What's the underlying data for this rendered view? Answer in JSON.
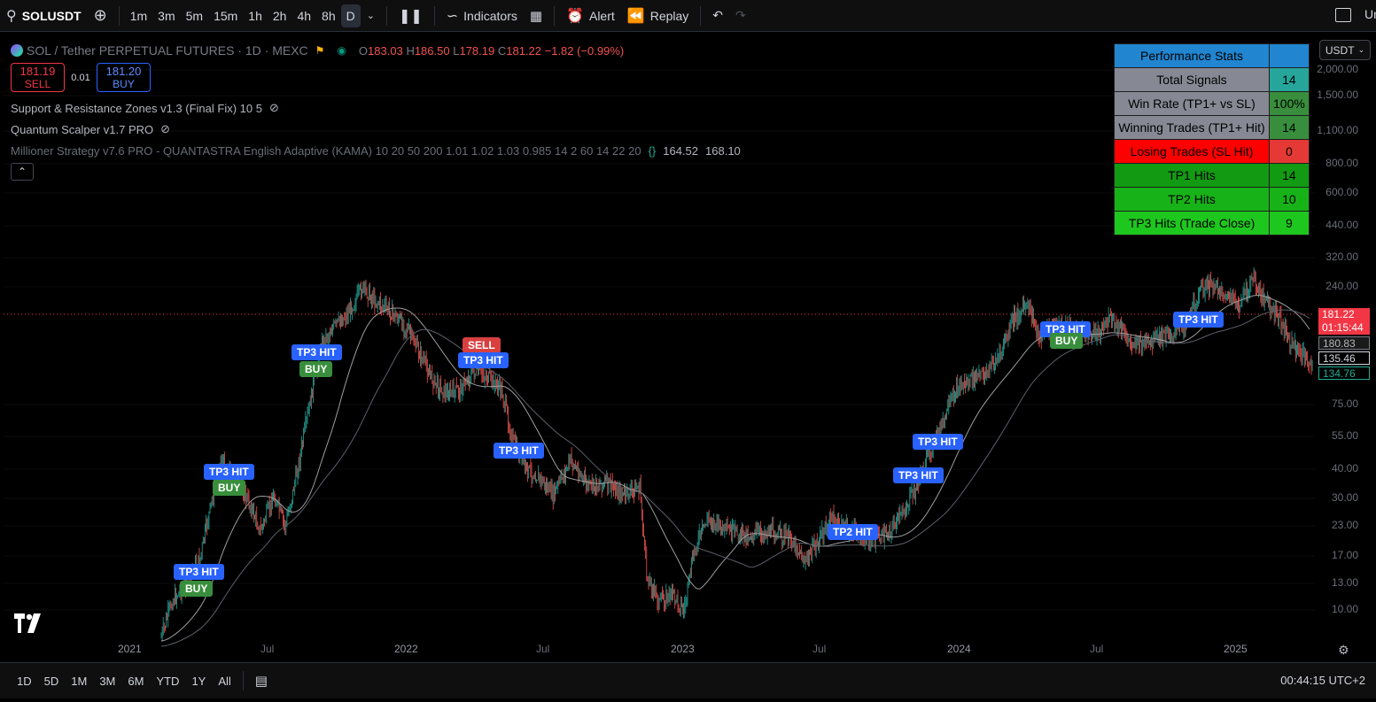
{
  "toolbar": {
    "symbol": "SOLUSDT",
    "timeframes": [
      "1m",
      "3m",
      "5m",
      "15m",
      "1h",
      "2h",
      "4h",
      "8h",
      "D"
    ],
    "active_timeframe": "D",
    "indicators_label": "Indicators",
    "alert_label": "Alert",
    "replay_label": "Replay",
    "right_cut_text": "Un"
  },
  "legend": {
    "title": "SOL / Tether PERPETUAL FUTURES · 1D · MEXC",
    "o_key": "O",
    "o_val": "183.03",
    "h_key": "H",
    "h_val": "186.50",
    "l_key": "L",
    "l_val": "178.19",
    "c_key": "C",
    "c_val": "181.22",
    "change": "−1.82 (−0.99%)",
    "sell_price": "181.19",
    "sell_label": "SELL",
    "spread": "0.01",
    "buy_price": "181.20",
    "buy_label": "BUY",
    "indicator1": "Support & Resistance Zones v1.3 (Final Fix) 10 5",
    "indicator2": "Quantum Scalper v1.7 PRO",
    "indicator3": "Millioner Strategy v7.6 PRO - QUANTASTRA English Adaptive (KAMA) 10 20 50 200 1.01 1.02 1.03 0.985 14 2 60 14 22 20",
    "indicator3_v1": "164.52",
    "indicator3_v2": "168.10"
  },
  "stats": {
    "header": "Performance Stats",
    "rows": [
      {
        "label": "Total Signals",
        "value": "14",
        "label_bg": "#868993",
        "value_bg": "#26a69a"
      },
      {
        "label": "Win Rate (TP1+ vs SL)",
        "value": "100%",
        "label_bg": "#868993",
        "value_bg": "#388e3c"
      },
      {
        "label": "Winning Trades (TP1+ Hit)",
        "value": "14",
        "label_bg": "#868993",
        "value_bg": "#388e3c"
      },
      {
        "label": "Losing Trades (SL Hit)",
        "value": "0",
        "label_bg": "#ff0000",
        "value_bg": "#e53935"
      },
      {
        "label": "TP1 Hits",
        "value": "14",
        "label_bg": "#139a13",
        "value_bg": "#139a13"
      },
      {
        "label": "TP2 Hits",
        "value": "10",
        "label_bg": "#17b217",
        "value_bg": "#17b217"
      },
      {
        "label": "TP3 Hits (Trade Close)",
        "value": "9",
        "label_bg": "#1ec71e",
        "value_bg": "#1ec71e"
      }
    ],
    "header_bg": "#2185d0"
  },
  "price_axis": {
    "currency": "USDT",
    "labels": [
      "2,000.00",
      "1,500.00",
      "1,100.00",
      "800.00",
      "600.00",
      "440.00",
      "320.00",
      "240.00",
      "75.00",
      "55.00",
      "40.00",
      "30.00",
      "23.00",
      "17.00",
      "13.00",
      "10.00"
    ],
    "current_price": "181.22",
    "countdown": "01:15:44",
    "tag2": "180.83",
    "tag3": "135.46",
    "tag4": "134.76"
  },
  "time_axis": {
    "labels": [
      "2021",
      "Jul",
      "2022",
      "Jul",
      "2023",
      "Jul",
      "2024",
      "Jul",
      "2025"
    ]
  },
  "signals": [
    {
      "text": "TP3 HIT",
      "kind": "tp"
    },
    {
      "text": "BUY",
      "kind": "buy"
    },
    {
      "text": "TP3 HIT",
      "kind": "tp"
    },
    {
      "text": "BUY",
      "kind": "buy"
    },
    {
      "text": "TP3 HIT",
      "kind": "tp"
    },
    {
      "text": "BUY",
      "kind": "buy"
    },
    {
      "text": "SELL",
      "kind": "sell"
    },
    {
      "text": "TP3 HIT",
      "kind": "tp"
    },
    {
      "text": "TP3 HIT",
      "kind": "tp"
    },
    {
      "text": "TP2 HIT",
      "kind": "tp"
    },
    {
      "text": "TP3 HIT",
      "kind": "tp"
    },
    {
      "text": "TP3 HIT",
      "kind": "tp"
    },
    {
      "text": "TP3 HIT",
      "kind": "tp"
    },
    {
      "text": "BUY",
      "kind": "buy"
    },
    {
      "text": "TP3 HIT",
      "kind": "tp"
    }
  ],
  "bottombar": {
    "ranges": [
      "1D",
      "5D",
      "1M",
      "3M",
      "6M",
      "YTD",
      "1Y",
      "All"
    ],
    "clock": "00:44:15 UTC+2"
  }
}
